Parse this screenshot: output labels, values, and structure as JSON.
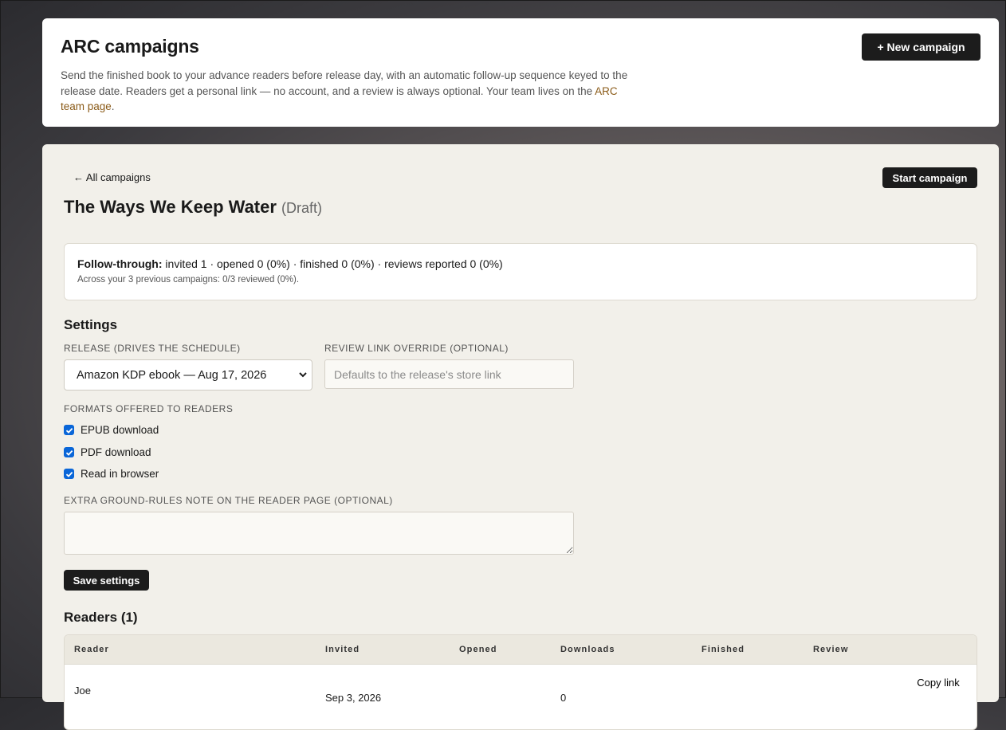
{
  "header": {
    "title": "ARC campaigns",
    "description": "Send the finished book to your advance readers before release day, with an automatic follow-up sequence keyed to the release date. Readers get a personal link — no account, and a review is always optional. Your team lives on the",
    "team_link": "ARC team page",
    "new_campaign_label": "+ New campaign"
  },
  "campaign": {
    "back_label": "← All campaigns",
    "start_label": "Start campaign",
    "title": "The Ways We Keep Water",
    "status": "(Draft)"
  },
  "followthrough": {
    "label": "Follow-through:",
    "stats": "invited 1 · opened 0 (0%) · finished 0 (0%) · reviews reported 0 (0%)",
    "history": "Across your 3 previous campaigns: 0/3 reviewed (0%)."
  },
  "settings": {
    "title": "Settings",
    "release_label": "Release (drives the schedule)",
    "release_value": "Amazon KDP ebook — Aug 17, 2026",
    "review_link_label": "Review link override (optional)",
    "review_link_placeholder": "Defaults to the release's store link",
    "formats_label": "Formats offered to readers",
    "formats": [
      {
        "label": "EPUB download",
        "checked": true
      },
      {
        "label": "PDF download",
        "checked": true
      },
      {
        "label": "Read in browser",
        "checked": true
      }
    ],
    "note_label": "Extra ground-rules note on the reader page (optional)",
    "save_label": "Save settings"
  },
  "readers": {
    "title": "Readers (1)",
    "columns": [
      "Reader",
      "Invited",
      "Opened",
      "Downloads",
      "Finished",
      "Review"
    ],
    "rows": [
      {
        "reader": "Joe",
        "invited": "Sep 3, 2026",
        "opened": "",
        "downloads": "0",
        "finished": "",
        "review": "",
        "action": "Copy link"
      }
    ]
  },
  "colors": {
    "accent_link": "#8a5a17",
    "button_dark": "#1c1c1c",
    "checkbox": "#0a66d8",
    "panel_bg": "#f2f0ea"
  }
}
